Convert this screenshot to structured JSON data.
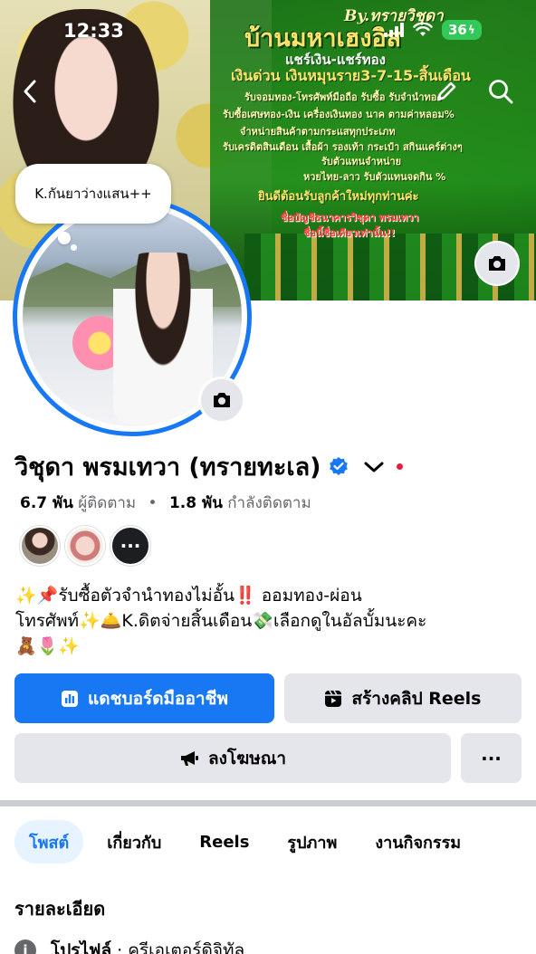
{
  "status_bar": {
    "time": "12:33",
    "battery": "36"
  },
  "cover": {
    "by_line": "By.ทรายวิชุดา",
    "shop_title": "บ้านมหาเฮงอิส",
    "lines": [
      "แชร์เงิน-แชร์ทอง",
      "เงินด่วน เงินหมุนราย3-7-15-สิ้นเดือน",
      "รับจอมทอง-โทรศัพท์มือถือ รับซื้อ รับจำนำทอง",
      "รับซื้อเศษทอง-เงิน เครื่องเงินทอง นาค ตามค่าหลอม%",
      "จำหน่ายสินค้าตามกระแสทุกประเภท",
      "รับเครดิตสินเดือน เสื้อผ้า รองเท้า กระเป๋า สกินแคร์ต่างๆ",
      "รับตัวแทนจำหน่าย",
      "หวยไทย-ลาว รับตัวแทนจดกิน %",
      "ยินดีต้อนรับลูกค้าใหม่ทุกท่านค่ะ",
      "ชื่อบัญชีธนาคารวิชุดา พรมเทวา",
      "ชื่อนี้ชื่อเดียวเท่านั้น!!"
    ]
  },
  "note": {
    "text": "K.กันยาว่างแสน++"
  },
  "profile": {
    "name": "วิชุดา พรมเทวา (ทรายทะเล)",
    "followers_count": "6.7 พัน",
    "followers_label": "ผู้ติดตาม",
    "separator": "•",
    "following_count": "1.8 พัน",
    "following_label": "กำลังติดตาม",
    "more_friends": "···",
    "bio_line1": "✨📌รับซื้อตัวจำนำทองไม่อั้น‼️ ออมทอง-ผ่อน",
    "bio_line2": "โทรศัพท์✨🛎️K.ดิตจ่ายสิ้นเดือน💸เลือกดูในอัลบั้มนะคะ",
    "bio_line3": "🧸🌷✨"
  },
  "actions": {
    "dashboard_label": "แดชบอร์ดมืออาชีพ",
    "reels_label": "สร้างคลิป Reels",
    "ads_label": "ลงโฆษณา",
    "more_label": "···"
  },
  "tabs": [
    {
      "label": "โพสต์"
    },
    {
      "label": "เกี่ยวกับ"
    },
    {
      "label": "Reels"
    },
    {
      "label": "รูปภาพ"
    },
    {
      "label": "งานกิจกรรม"
    }
  ],
  "details": {
    "title": "รายละเอียด",
    "profile_prefix": "โปรไฟล์",
    "profile_value": " · ครีเอเตอร์ดิจิทัล"
  },
  "colors": {
    "accent": "#1877f2",
    "button_gray": "#e4e6eb",
    "text_secondary": "#65676b",
    "battery": "#34c759"
  }
}
